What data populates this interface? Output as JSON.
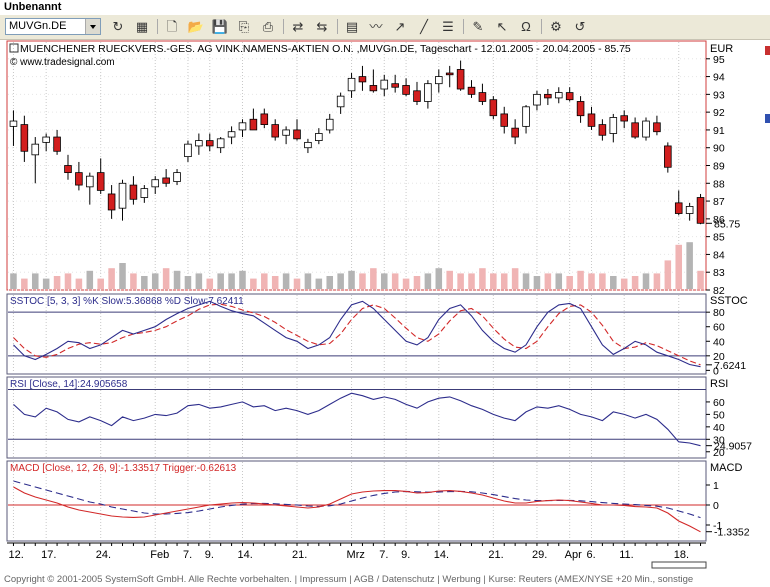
{
  "window": {
    "title": "Unbenannt"
  },
  "toolbar": {
    "symbol": "MUVGn.DE",
    "buttons": [
      {
        "name": "refresh-icon",
        "glyph": "↻"
      },
      {
        "name": "calendar-icon",
        "glyph": "▦"
      },
      {
        "name": "new-document-icon",
        "glyph": "🗋"
      },
      {
        "name": "open-folder-icon",
        "glyph": "📂"
      },
      {
        "name": "save-icon",
        "glyph": "💾"
      },
      {
        "name": "copy-icon",
        "glyph": "⎘"
      },
      {
        "name": "print-icon",
        "glyph": "⎙"
      },
      {
        "name": "chart-compare-icon",
        "glyph": "⇄"
      },
      {
        "name": "chart-swap-icon",
        "glyph": "⇆"
      },
      {
        "name": "chart-type-icon",
        "glyph": "▤"
      },
      {
        "name": "indicator-icon",
        "glyph": "〰"
      },
      {
        "name": "trend-icon",
        "glyph": "↗"
      },
      {
        "name": "line-tool-icon",
        "glyph": "╱"
      },
      {
        "name": "properties-icon",
        "glyph": "☰"
      },
      {
        "name": "drawing-icon",
        "glyph": "✎"
      },
      {
        "name": "pointer-icon",
        "glyph": "↖"
      },
      {
        "name": "magnet-icon",
        "glyph": "Ω"
      },
      {
        "name": "settings-icon",
        "glyph": "⚙"
      },
      {
        "name": "undo-icon",
        "glyph": "↺"
      }
    ]
  },
  "colors": {
    "up_candle": "#ffffff",
    "down_candle": "#d21e1e",
    "volume_up": "#b4b4b4",
    "volume_down": "#f0b4b4",
    "price_border": "#d23c3c",
    "panel_border": "#5a5a78",
    "grid": "#c8c8c8",
    "line_blue": "#2d2d8c",
    "line_red": "#d22828",
    "band_line": "#3c3c78",
    "zero_line": "#d22828"
  },
  "chart_data": {
    "type": "candlestick",
    "title": "MUENCHENER RUECKVERS.-GES. AG VINK.NAMENS-AKTIEN O.N. ,MUVGn.DE, Tageschart - 12.01.2005 - 20.04.2005 - 85.75",
    "source": "© www.tradesignal.com",
    "currency": "EUR",
    "last_label": "85.75",
    "price_ylim": [
      82,
      96
    ],
    "price_ticks": [
      "82",
      "83",
      "84",
      "85",
      "86",
      "87",
      "88",
      "89",
      "90",
      "91",
      "92",
      "93",
      "94",
      "95"
    ],
    "ohlc": [
      [
        91.2,
        92.1,
        90.1,
        91.5
      ],
      [
        91.3,
        91.8,
        89.2,
        89.8
      ],
      [
        89.6,
        90.6,
        88.0,
        90.2
      ],
      [
        90.3,
        90.8,
        89.8,
        90.6
      ],
      [
        90.6,
        91.0,
        89.6,
        89.8
      ],
      [
        89.0,
        89.6,
        88.2,
        88.6
      ],
      [
        88.6,
        89.2,
        87.6,
        87.9
      ],
      [
        87.8,
        88.6,
        86.8,
        88.4
      ],
      [
        88.6,
        89.4,
        87.4,
        87.6
      ],
      [
        87.4,
        87.9,
        86.0,
        86.5
      ],
      [
        86.6,
        88.2,
        85.9,
        88.0
      ],
      [
        87.9,
        88.4,
        86.8,
        87.1
      ],
      [
        87.2,
        87.9,
        86.9,
        87.7
      ],
      [
        87.8,
        88.4,
        87.4,
        88.2
      ],
      [
        88.3,
        88.8,
        87.8,
        88.0
      ],
      [
        88.1,
        88.8,
        87.9,
        88.6
      ],
      [
        89.5,
        90.4,
        89.2,
        90.2
      ],
      [
        90.1,
        90.8,
        89.6,
        90.4
      ],
      [
        90.4,
        90.8,
        89.8,
        90.1
      ],
      [
        90.0,
        90.6,
        89.7,
        90.5
      ],
      [
        90.6,
        91.2,
        90.2,
        90.9
      ],
      [
        91.0,
        91.6,
        90.6,
        91.4
      ],
      [
        91.6,
        92.2,
        91.1,
        91.0
      ],
      [
        91.9,
        92.2,
        91.1,
        91.3
      ],
      [
        91.3,
        91.6,
        90.4,
        90.6
      ],
      [
        90.7,
        91.2,
        90.2,
        91.0
      ],
      [
        91.0,
        91.6,
        90.4,
        90.5
      ],
      [
        90.0,
        90.5,
        89.7,
        90.3
      ],
      [
        90.4,
        91.1,
        90.2,
        90.8
      ],
      [
        91.0,
        91.9,
        90.8,
        91.6
      ],
      [
        92.3,
        93.1,
        91.9,
        92.9
      ],
      [
        93.2,
        94.2,
        92.8,
        93.9
      ],
      [
        94.0,
        94.6,
        93.2,
        93.7
      ],
      [
        93.5,
        94.4,
        93.1,
        93.2
      ],
      [
        93.3,
        94.1,
        92.9,
        93.8
      ],
      [
        93.6,
        94.1,
        93.1,
        93.4
      ],
      [
        93.5,
        93.9,
        92.9,
        93.0
      ],
      [
        93.2,
        93.7,
        92.4,
        92.6
      ],
      [
        92.6,
        93.8,
        92.2,
        93.6
      ],
      [
        93.6,
        94.4,
        93.1,
        94.0
      ],
      [
        94.2,
        94.6,
        93.4,
        94.1
      ],
      [
        94.4,
        94.9,
        93.2,
        93.3
      ],
      [
        93.4,
        93.8,
        92.8,
        93.0
      ],
      [
        93.1,
        93.6,
        92.4,
        92.6
      ],
      [
        92.7,
        92.9,
        91.6,
        91.8
      ],
      [
        91.9,
        92.3,
        90.8,
        91.2
      ],
      [
        91.1,
        91.6,
        90.2,
        90.6
      ],
      [
        91.2,
        92.4,
        90.8,
        92.3
      ],
      [
        92.4,
        93.2,
        92.1,
        93.0
      ],
      [
        93.0,
        93.3,
        92.4,
        92.8
      ],
      [
        92.8,
        93.4,
        92.5,
        93.1
      ],
      [
        93.1,
        93.4,
        92.6,
        92.7
      ],
      [
        92.6,
        92.9,
        91.4,
        91.8
      ],
      [
        91.9,
        92.3,
        91.0,
        91.2
      ],
      [
        91.3,
        91.6,
        90.4,
        90.7
      ],
      [
        90.8,
        91.9,
        90.3,
        91.7
      ],
      [
        91.8,
        92.1,
        91.1,
        91.5
      ],
      [
        91.4,
        91.7,
        90.5,
        90.6
      ],
      [
        90.6,
        91.7,
        90.4,
        91.5
      ],
      [
        91.4,
        91.8,
        90.7,
        90.9
      ],
      [
        90.1,
        90.3,
        88.6,
        88.9
      ],
      [
        86.9,
        87.6,
        86.2,
        86.3
      ],
      [
        86.3,
        86.9,
        85.9,
        86.7
      ],
      [
        87.2,
        87.4,
        85.7,
        85.75
      ]
    ],
    "volume": [
      0.3,
      0.2,
      0.3,
      0.2,
      0.25,
      0.3,
      0.2,
      0.35,
      0.2,
      0.4,
      0.5,
      0.3,
      0.25,
      0.3,
      0.4,
      0.35,
      0.25,
      0.3,
      0.2,
      0.3,
      0.3,
      0.35,
      0.2,
      0.3,
      0.25,
      0.3,
      0.2,
      0.3,
      0.2,
      0.25,
      0.3,
      0.35,
      0.3,
      0.4,
      0.3,
      0.3,
      0.2,
      0.25,
      0.3,
      0.4,
      0.35,
      0.3,
      0.3,
      0.4,
      0.3,
      0.3,
      0.4,
      0.3,
      0.25,
      0.3,
      0.3,
      0.25,
      0.35,
      0.3,
      0.3,
      0.25,
      0.2,
      0.25,
      0.3,
      0.3,
      0.55,
      0.85,
      0.9,
      0.35
    ],
    "stoch": {
      "label": "SSTOC [5, 3, 3] %K Slow:5.36868 %D Slow:7.62411",
      "axis_name": "SSTOC",
      "last_label": "7.6241",
      "ylim": [
        -5,
        105
      ],
      "ticks": [
        "0",
        "20",
        "40",
        "60",
        "80"
      ],
      "bands": [
        20,
        80
      ],
      "k": [
        35,
        20,
        15,
        22,
        30,
        40,
        38,
        30,
        35,
        45,
        55,
        50,
        55,
        60,
        70,
        78,
        85,
        90,
        95,
        88,
        82,
        78,
        75,
        65,
        55,
        45,
        40,
        30,
        35,
        45,
        70,
        90,
        95,
        85,
        70,
        55,
        40,
        35,
        45,
        70,
        85,
        90,
        75,
        55,
        40,
        30,
        25,
        35,
        60,
        80,
        90,
        92,
        85,
        60,
        35,
        22,
        30,
        40,
        35,
        25,
        20,
        15,
        8,
        5
      ],
      "d": [
        45,
        30,
        20,
        18,
        22,
        30,
        36,
        38,
        36,
        38,
        45,
        50,
        52,
        55,
        60,
        68,
        75,
        84,
        90,
        91,
        88,
        83,
        79,
        74,
        66,
        56,
        48,
        40,
        35,
        37,
        50,
        70,
        85,
        90,
        85,
        72,
        58,
        45,
        40,
        50,
        68,
        82,
        85,
        75,
        58,
        43,
        32,
        30,
        40,
        60,
        78,
        88,
        90,
        80,
        62,
        40,
        30,
        32,
        38,
        34,
        27,
        20,
        13,
        7.6
      ]
    },
    "rsi": {
      "label": "RSI [Close, 14]:24.905658",
      "axis_name": "RSI",
      "last_label": "24.9057",
      "ylim": [
        15,
        80
      ],
      "ticks": [
        "20",
        "30",
        "40",
        "50",
        "60"
      ],
      "bands": [
        30,
        70
      ],
      "values": [
        58,
        50,
        48,
        55,
        52,
        46,
        44,
        48,
        45,
        41,
        48,
        45,
        47,
        50,
        49,
        51,
        57,
        58,
        55,
        56,
        58,
        60,
        56,
        57,
        53,
        55,
        53,
        50,
        53,
        58,
        63,
        67,
        65,
        62,
        64,
        62,
        58,
        55,
        60,
        63,
        64,
        61,
        57,
        54,
        50,
        47,
        45,
        52,
        56,
        55,
        57,
        54,
        50,
        48,
        45,
        52,
        50,
        47,
        50,
        46,
        38,
        28,
        27,
        24.9
      ]
    },
    "macd": {
      "label": "MACD [Close, 12, 26, 9]:-1.33517 Trigger:-0.62613",
      "axis_name": "MACD",
      "last_label": "-1.3352",
      "ylim": [
        -1.8,
        2.2
      ],
      "ticks": [
        "-1",
        "0",
        "1"
      ],
      "zero": 0,
      "macd": [
        0.9,
        0.6,
        0.4,
        0.25,
        0.1,
        -0.1,
        -0.25,
        -0.35,
        -0.45,
        -0.55,
        -0.6,
        -0.62,
        -0.6,
        -0.5,
        -0.4,
        -0.3,
        -0.2,
        -0.1,
        0.0,
        0.05,
        0.1,
        0.12,
        0.1,
        0.05,
        0.0,
        -0.05,
        -0.1,
        -0.15,
        -0.1,
        0.05,
        0.3,
        0.55,
        0.65,
        0.7,
        0.72,
        0.72,
        0.68,
        0.6,
        0.62,
        0.7,
        0.72,
        0.68,
        0.6,
        0.5,
        0.35,
        0.2,
        0.1,
        0.1,
        0.18,
        0.22,
        0.25,
        0.22,
        0.15,
        0.08,
        0.0,
        0.0,
        -0.02,
        -0.08,
        -0.1,
        -0.15,
        -0.4,
        -0.8,
        -1.05,
        -1.34
      ],
      "trigger": [
        1.2,
        1.05,
        0.9,
        0.75,
        0.6,
        0.45,
        0.3,
        0.15,
        0.05,
        -0.1,
        -0.2,
        -0.3,
        -0.4,
        -0.45,
        -0.45,
        -0.42,
        -0.38,
        -0.3,
        -0.2,
        -0.1,
        -0.02,
        0.04,
        0.07,
        0.08,
        0.06,
        0.03,
        0.0,
        -0.05,
        -0.07,
        -0.04,
        0.05,
        0.2,
        0.35,
        0.48,
        0.58,
        0.65,
        0.68,
        0.66,
        0.64,
        0.65,
        0.67,
        0.68,
        0.66,
        0.6,
        0.52,
        0.42,
        0.32,
        0.25,
        0.22,
        0.22,
        0.23,
        0.23,
        0.21,
        0.17,
        0.12,
        0.08,
        0.05,
        0.02,
        -0.02,
        -0.06,
        -0.15,
        -0.3,
        -0.45,
        -0.63
      ]
    },
    "x_ticks": [
      {
        "i": 0,
        "label": "12."
      },
      {
        "i": 3,
        "label": "17."
      },
      {
        "i": 8,
        "label": "24."
      },
      {
        "i": 13,
        "label": "Feb"
      },
      {
        "i": 16,
        "label": "7."
      },
      {
        "i": 18,
        "label": "9."
      },
      {
        "i": 21,
        "label": "14."
      },
      {
        "i": 26,
        "label": "21."
      },
      {
        "i": 31,
        "label": "Mrz"
      },
      {
        "i": 34,
        "label": "7."
      },
      {
        "i": 36,
        "label": "9."
      },
      {
        "i": 39,
        "label": "14."
      },
      {
        "i": 44,
        "label": "21."
      },
      {
        "i": 48,
        "label": "29."
      },
      {
        "i": 51,
        "label": "Apr"
      },
      {
        "i": 53,
        "label": "6."
      },
      {
        "i": 56,
        "label": "11."
      },
      {
        "i": 61,
        "label": "18."
      }
    ]
  },
  "footer": {
    "text": "Copyright © 2001-2005 SystemSoft GmbH. Alle Rechte vorbehalten. | Impressum | AGB / Datenschutz | Werbung | Kurse: Reuters (AMEX/NYSE +20 Min., sonstige"
  }
}
